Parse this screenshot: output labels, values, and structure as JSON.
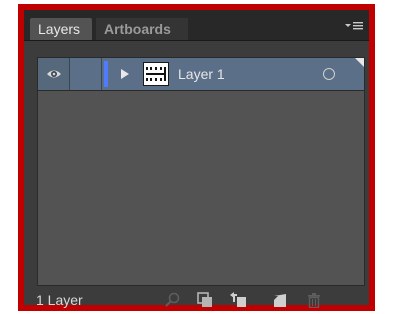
{
  "panel": {
    "tabs": [
      {
        "label": "Layers",
        "active": true
      },
      {
        "label": "Artboards",
        "active": false
      }
    ],
    "menu_icon": "panel-menu-icon"
  },
  "layers": [
    {
      "name": "Layer 1",
      "visible": true,
      "locked": false,
      "expanded": false,
      "color": "#4f7cff",
      "selected": true
    }
  ],
  "footer": {
    "count_label": "1 Layer",
    "buttons": [
      "locate-object-icon",
      "make-clipping-mask-icon",
      "create-sublayer-icon",
      "create-layer-icon",
      "delete-icon"
    ]
  },
  "colors": {
    "frame_border": "#c00000",
    "row_selected": "#5b7088",
    "panel_bg": "#535353"
  }
}
